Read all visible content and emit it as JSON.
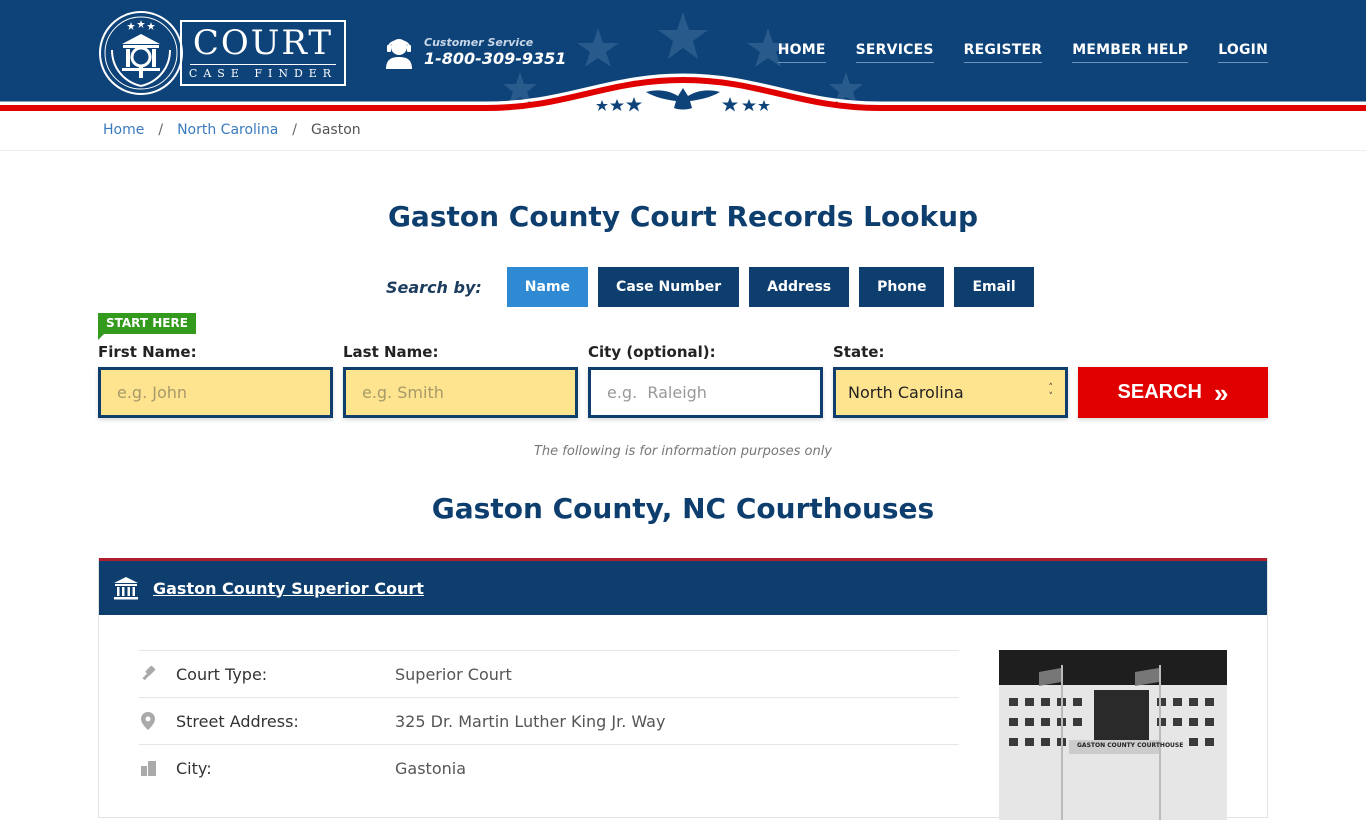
{
  "brand": {
    "name": "COURT",
    "subtitle": "CASE FINDER"
  },
  "customer_service": {
    "label": "Customer Service",
    "phone": "1-800-309-9351"
  },
  "nav": {
    "items": [
      {
        "label": "HOME"
      },
      {
        "label": "SERVICES"
      },
      {
        "label": "REGISTER"
      },
      {
        "label": "MEMBER HELP"
      },
      {
        "label": "LOGIN"
      }
    ]
  },
  "breadcrumb": {
    "items": [
      {
        "label": "Home"
      },
      {
        "label": "North Carolina"
      },
      {
        "label": "Gaston"
      }
    ],
    "separator": "/"
  },
  "page_title": "Gaston County Court Records Lookup",
  "search_by": {
    "label": "Search by:",
    "tabs": [
      {
        "label": "Name",
        "active": true
      },
      {
        "label": "Case Number",
        "active": false
      },
      {
        "label": "Address",
        "active": false
      },
      {
        "label": "Phone",
        "active": false
      },
      {
        "label": "Email",
        "active": false
      }
    ]
  },
  "form": {
    "start_here": "START HERE",
    "first_name": {
      "label": "First Name:",
      "placeholder": "e.g. John",
      "value": ""
    },
    "last_name": {
      "label": "Last Name:",
      "placeholder": "e.g. Smith",
      "value": ""
    },
    "city": {
      "label": "City (optional):",
      "placeholder": "e.g.  Raleigh",
      "value": ""
    },
    "state": {
      "label": "State:",
      "value": "North Carolina"
    },
    "search_button": "SEARCH",
    "search_button_icon": "»"
  },
  "info_note": "The following is for information purposes only",
  "section_title": "Gaston County, NC Courthouses",
  "court": {
    "name": "Gaston County Superior Court",
    "rows": [
      {
        "icon": "gavel-icon",
        "label": "Court Type:",
        "value": "Superior Court"
      },
      {
        "icon": "map-pin-icon",
        "label": "Street Address:",
        "value": "325 Dr. Martin Luther King Jr. Way"
      },
      {
        "icon": "city-icon",
        "label": "City:",
        "value": "Gastonia"
      }
    ],
    "photo_caption": "GASTON COUNTY COURTHOUSE"
  },
  "colors": {
    "navy": "#0d3e6e",
    "accent_blue": "#2f8ad3",
    "red": "#e10000",
    "input_yellow": "#ffe48f",
    "start_green": "#339a1e"
  }
}
